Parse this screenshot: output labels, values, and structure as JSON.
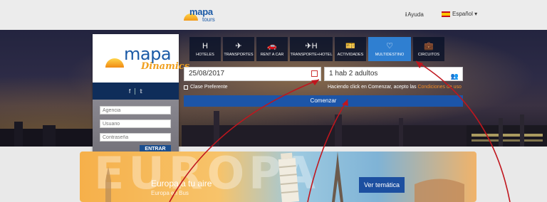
{
  "header": {
    "tours_logo_brand": "mapa",
    "tours_logo_sub": "tours",
    "help_label": "Ayuda",
    "language_label": "Español ▾"
  },
  "login": {
    "logo_mapa": "mapa",
    "logo_dinamics": "Dinamics",
    "social_facebook": "f",
    "social_twitter": "🐦",
    "agency_placeholder": "Agencia",
    "user_placeholder": "Usuario",
    "password_placeholder": "Contraseña",
    "submit_label": "ENTRAR"
  },
  "tabs": [
    {
      "label": "HOTELES",
      "icon": "H"
    },
    {
      "label": "TRANSPORTES",
      "icon": "✈"
    },
    {
      "label": "RENT A CAR",
      "icon": "🚗"
    },
    {
      "label": "TRANSPORTE+HOTEL",
      "icon": "✈H"
    },
    {
      "label": "ACTIVIDADES",
      "icon": "🎫"
    },
    {
      "label": "MULTIDESTINO",
      "icon": "♡"
    },
    {
      "label": "CIRCUITOS",
      "icon": "💼"
    }
  ],
  "search": {
    "date_value": "25/08/2017",
    "rooms_value": "1 hab 2 adultos",
    "preferred_class_label": "Clase Preferente",
    "terms_text": "Haciendo click en Comenzar, acepto las",
    "terms_link": "Condiciones de uso",
    "submit_label": "Comenzar"
  },
  "banner": {
    "watermark": "EUROPA",
    "headline": "Europa a tu aire",
    "subline": "Europa en Bus",
    "cta_label": "Ver temática"
  },
  "colors": {
    "accent": "#1c55a8",
    "active_tab": "#2f7fd1",
    "arrow": "#c0161e",
    "brand_orange": "#f0a020"
  }
}
